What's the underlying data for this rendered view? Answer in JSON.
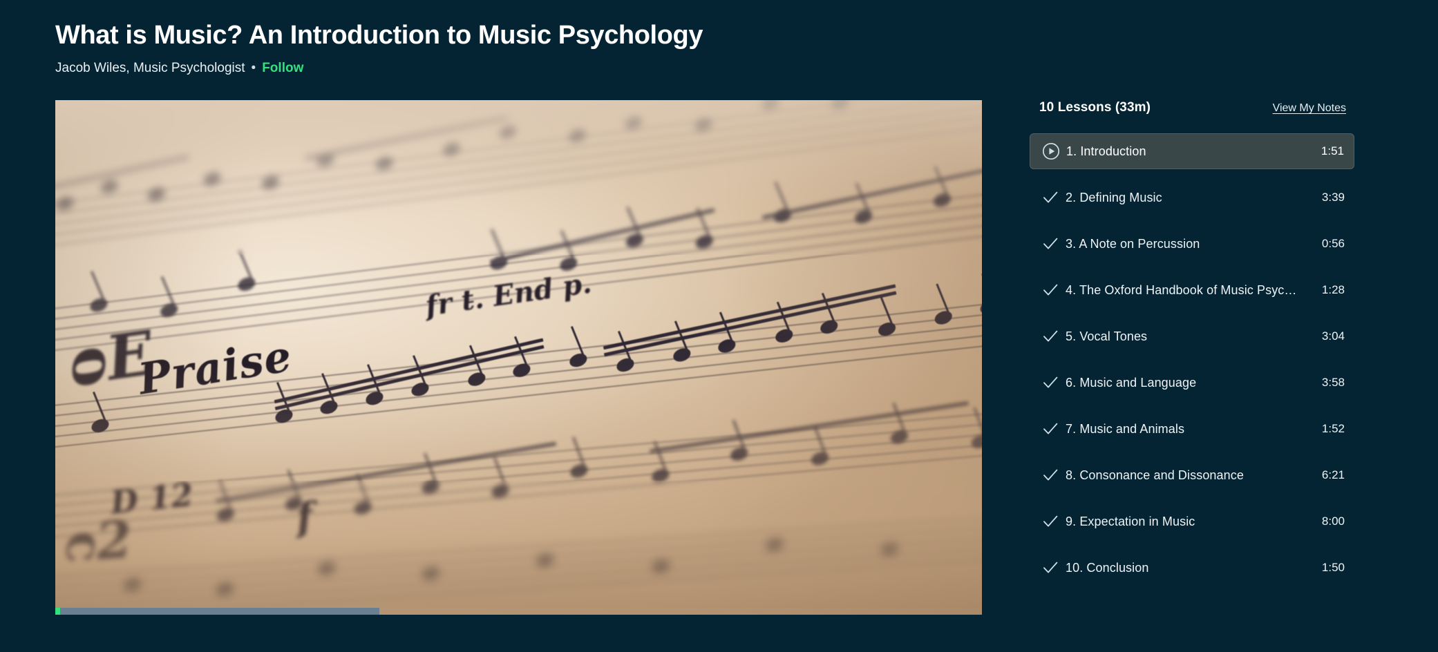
{
  "colors": {
    "background": "#042433",
    "accent_green": "#35e07f",
    "active_row_bg": "#3a4749",
    "progress_buffer": "#6b7f92",
    "text_primary": "#ffffff",
    "text_secondary": "#e6eef2"
  },
  "header": {
    "title": "What is Music? An Introduction to Music Psychology",
    "author": "Jacob Wiles, Music Psychologist",
    "separator": "•",
    "follow_label": "Follow"
  },
  "video": {
    "description": "Close-up of handwritten sheet music manuscript on aged cream paper",
    "script_words": {
      "praise": "Praise",
      "phrase": "fr t̵. End p.",
      "keysig": "D 12",
      "dynamic": "f",
      "clef": "ᴑE",
      "scribble": "ᴒ2"
    },
    "progress": {
      "played_percent": 0.5,
      "buffered_percent": 35
    }
  },
  "sidebar": {
    "lessons_count_label": "10 Lessons (33m)",
    "notes_link_label": "View My Notes",
    "lessons": [
      {
        "label": "1. Introduction",
        "duration": "1:51",
        "state": "playing",
        "icon": "play-circle-icon"
      },
      {
        "label": "2. Defining Music",
        "duration": "3:39",
        "state": "completed",
        "icon": "check-icon"
      },
      {
        "label": "3. A Note on Percussion",
        "duration": "0:56",
        "state": "completed",
        "icon": "check-icon"
      },
      {
        "label": "4. The Oxford Handbook of Music Psyc…",
        "duration": "1:28",
        "state": "completed",
        "icon": "check-icon"
      },
      {
        "label": "5. Vocal Tones",
        "duration": "3:04",
        "state": "completed",
        "icon": "check-icon"
      },
      {
        "label": "6. Music and Language",
        "duration": "3:58",
        "state": "completed",
        "icon": "check-icon"
      },
      {
        "label": "7. Music and Animals",
        "duration": "1:52",
        "state": "completed",
        "icon": "check-icon"
      },
      {
        "label": "8. Consonance and Dissonance",
        "duration": "6:21",
        "state": "completed",
        "icon": "check-icon"
      },
      {
        "label": "9. Expectation in Music",
        "duration": "8:00",
        "state": "completed",
        "icon": "check-icon"
      },
      {
        "label": "10. Conclusion",
        "duration": "1:50",
        "state": "completed",
        "icon": "check-icon"
      }
    ]
  }
}
